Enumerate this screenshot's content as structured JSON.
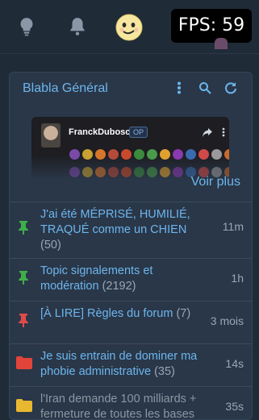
{
  "top_bar": {
    "icons": [
      "lightbulb-icon",
      "bell-icon",
      "smiley-avatar-icon"
    ],
    "fps_label": "FPS: 59"
  },
  "forum_card": {
    "title": "Blabla Général",
    "actions": [
      "more-vertical-icon",
      "search-icon",
      "refresh-icon"
    ],
    "banner": {
      "username": "FranckDubosc",
      "op_badge": "OP",
      "badge_colors": [
        "#7a4aa8",
        "#c9a032",
        "#d6762a",
        "#b54a3a",
        "#c84a2c",
        "#3c8a3e",
        "#4a9a4a",
        "#e0a030",
        "#8a3ab0",
        "#3a6ab0",
        "#d04a4a",
        "#9a9a9a",
        "#c86a30",
        "#6a4a9a"
      ]
    },
    "voir_plus": "Voir plus",
    "topics": [
      {
        "title": "J'ai été MÉPRISÉ, HUMILIÉ, TRAQUÉ comme un CHIEN",
        "count": "(50)",
        "time": "11m",
        "pin": "green"
      },
      {
        "title": "Topic signalements et modération",
        "count": "(2192)",
        "time": "1h",
        "pin": "green"
      },
      {
        "title": "[À LIRE] Règles du forum",
        "count": "(7)",
        "time": "3 mois",
        "pin": "red"
      },
      {
        "title": "Je suis entrain de dominer ma phobie administrative",
        "count": "(35)",
        "time": "14s",
        "pin": "red-folder"
      },
      {
        "title": "l'Iran demande 100 milliards + fermeture de toutes les bases",
        "count": "",
        "time": "35s",
        "pin": "yellow-folder"
      }
    ]
  },
  "colors": {
    "background": "#202b38",
    "card": "#2a3748",
    "link": "#6cb6ee",
    "pin_green": "#3fae4a",
    "pin_red": "#e24a4a",
    "folder_red": "#e2443a",
    "folder_yellow": "#e8b830"
  }
}
